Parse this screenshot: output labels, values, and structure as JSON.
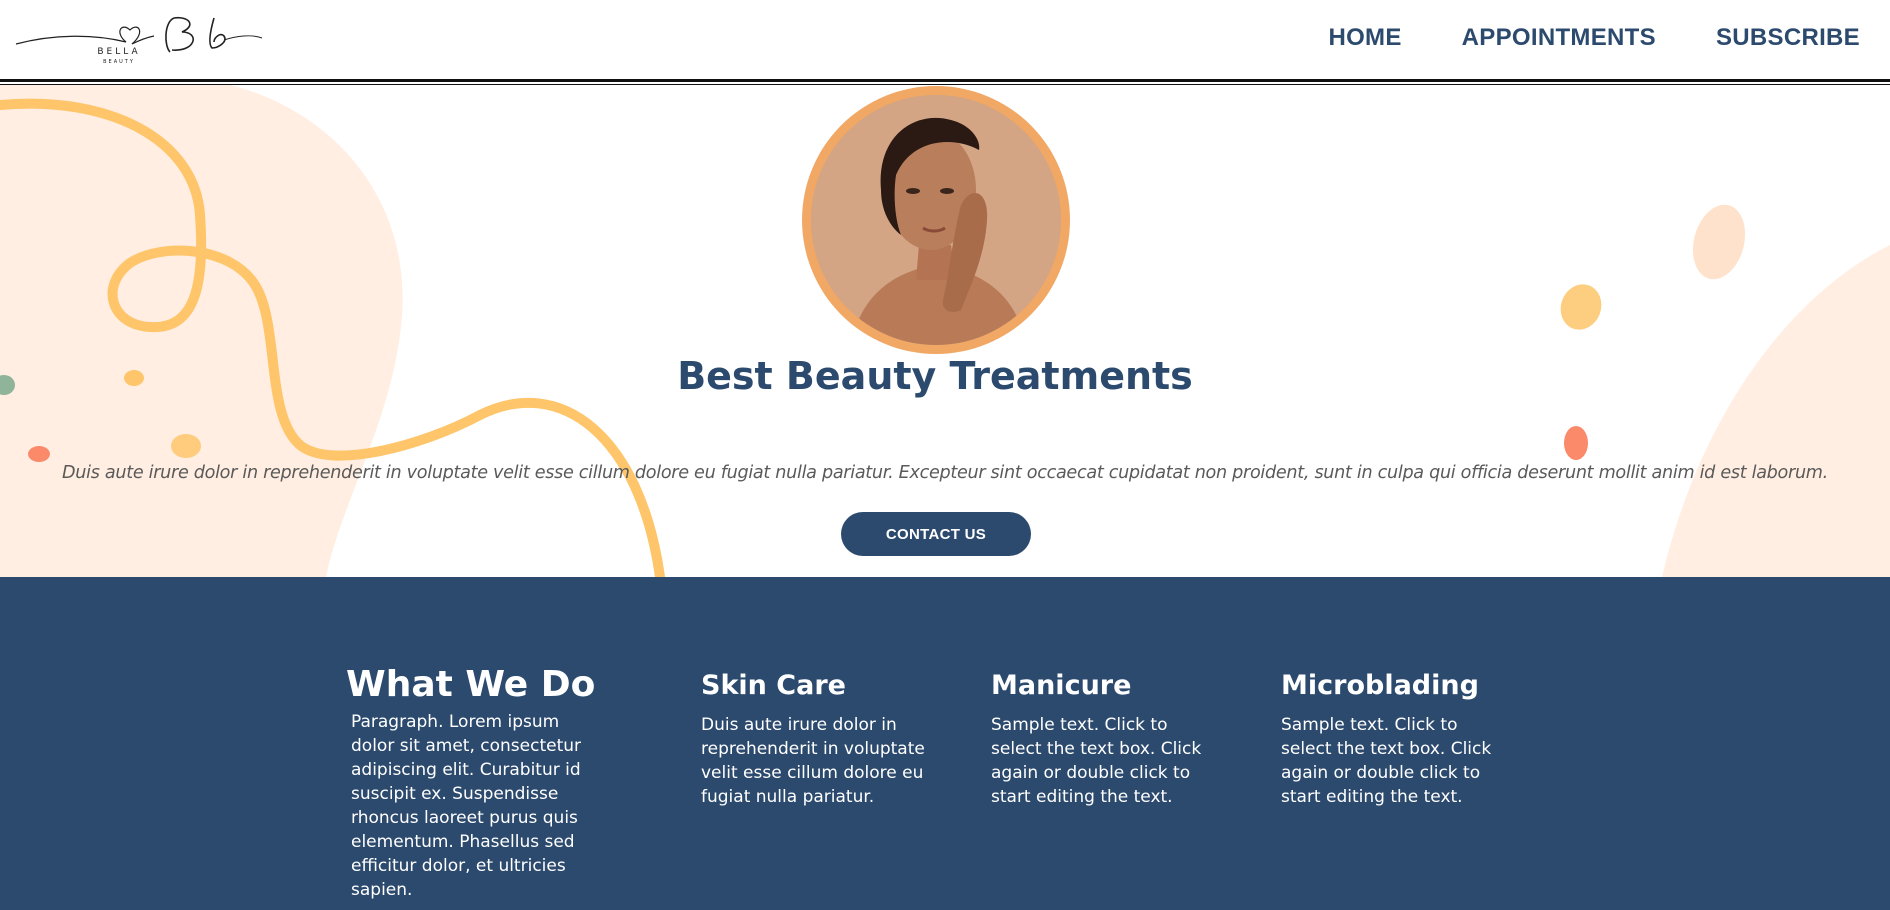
{
  "header": {
    "logo": {
      "name": "BELLA",
      "tagline": "BEAUTY",
      "monogram": "Bb"
    },
    "nav": [
      {
        "label": "HOME"
      },
      {
        "label": "APPOINTMENTS"
      },
      {
        "label": "SUBSCRIBE"
      }
    ]
  },
  "hero": {
    "title": "Best Beauty Treatments",
    "text": "Duis aute irure dolor in reprehenderit in voluptate velit esse cillum dolore eu fugiat nulla pariatur. Excepteur sint occaecat cupidatat non proident, sunt in culpa qui officia deserunt mollit anim id est laborum.",
    "button_label": "CONTACT US"
  },
  "services": {
    "intro": {
      "title": "What We Do",
      "text": "Paragraph. Lorem ipsum dolor sit amet, consectetur adipiscing elit. Curabitur id suscipit ex. Suspendisse rhoncus laoreet purus quis elementum. Phasellus sed efficitur dolor, et ultricies sapien."
    },
    "items": [
      {
        "title": "Skin Care",
        "text": "Duis aute irure dolor in reprehenderit in voluptate velit esse cillum dolore eu fugiat nulla pariatur."
      },
      {
        "title": "Manicure",
        "text": "Sample text. Click to select the text box. Click again or double click to start editing the text."
      },
      {
        "title": "Microblading",
        "text": "Sample text. Click to select the text box. Click again or double click to start editing the text."
      }
    ]
  },
  "colors": {
    "navy": "#2c4a6e",
    "peach_blob": "#ffeee1",
    "yellow_squiggle": "#fec56a",
    "orange_ring": "#f1a865",
    "coral_dot": "#fb8a6b",
    "sage_dot": "#8fb49a"
  }
}
